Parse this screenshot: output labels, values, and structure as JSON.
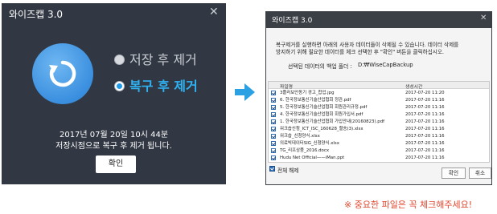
{
  "left_dialog": {
    "title": "와이즈캡 3.0",
    "close_glyph": "✕",
    "logo_icon": "refresh-arrow-icon",
    "option_delete_label": "저장 후 제거",
    "option_restore_label": "복구 후 제거",
    "selected_option": "restore",
    "message_line1": "2017년 07월 20일 10시 44분",
    "message_line2": "저장시점으로 복구 후 제거 됩니다.",
    "ok_label": "확인",
    "colors": {
      "background": "#313843",
      "accent": "#2fb2f2",
      "logo": "#3a8fdf"
    }
  },
  "arrow_icon": "right-arrow-icon",
  "right_dialog": {
    "title": "와이즈캡 3.0",
    "close_glyph": "✕",
    "description_line1": "복구제거를 실행하면 아래의 사용자 데이터들이 삭제될 수 있습니다. 데이터 삭제를",
    "description_line2": "방지하기 위해 필요한 데이터를 체크 선택한 후 \"확인\" 버튼을 클릭하십시오.",
    "backup_folder_label": "선택된 데이터의 백업 폴더 :",
    "backup_folder_value": "D:₩WiseCapBackup",
    "columns": {
      "name": "파일명",
      "date": "생성시간"
    },
    "files": [
      {
        "name": "3플러보안동기 경고_합업.jpg",
        "date": "2017-07-20 11:20"
      },
      {
        "name": "6. 한국정보통신기술산업협회 정관.pdf",
        "date": "2017-07-20 11:16"
      },
      {
        "name": "5. 한국정보통신기술산업협회 회원관리규정.pdf",
        "date": "2017-07-20 11:16"
      },
      {
        "name": "4. 한국정보통신기술산업협회 회원가입서.pdf",
        "date": "2017-07-20 11:16"
      },
      {
        "name": "1. 한국정보통신기술산업협회 가입안내(20160823).pdf",
        "date": "2017-07-20 11:16"
      },
      {
        "name": "워크숍신청_ICT_ISC_160628_할송(3).xlsx",
        "date": "2017-07-20 11:16"
      },
      {
        "name": "워크숍_신청양식.xlsx",
        "date": "2017-07-20 11:16"
      },
      {
        "name": "의료빅데이터SIG_신청양식.xlsx",
        "date": "2017-07-20 11:16"
      },
      {
        "name": "TG_리프상품_2016.docx",
        "date": "2017-07-20 11:16"
      },
      {
        "name": "Hudu Net Official——iMan.ppt",
        "date": "2017-07-20 11:16"
      }
    ],
    "select_all_label": "전체 해제",
    "ok_label": "확인",
    "cancel_label": "취소"
  },
  "note": "※ 중요한 파일은 꼭 체크해주세요!",
  "colors": {
    "note": "#e2452c",
    "arrow": "#2ba1e3",
    "checkbox": "#2b6fb8"
  }
}
